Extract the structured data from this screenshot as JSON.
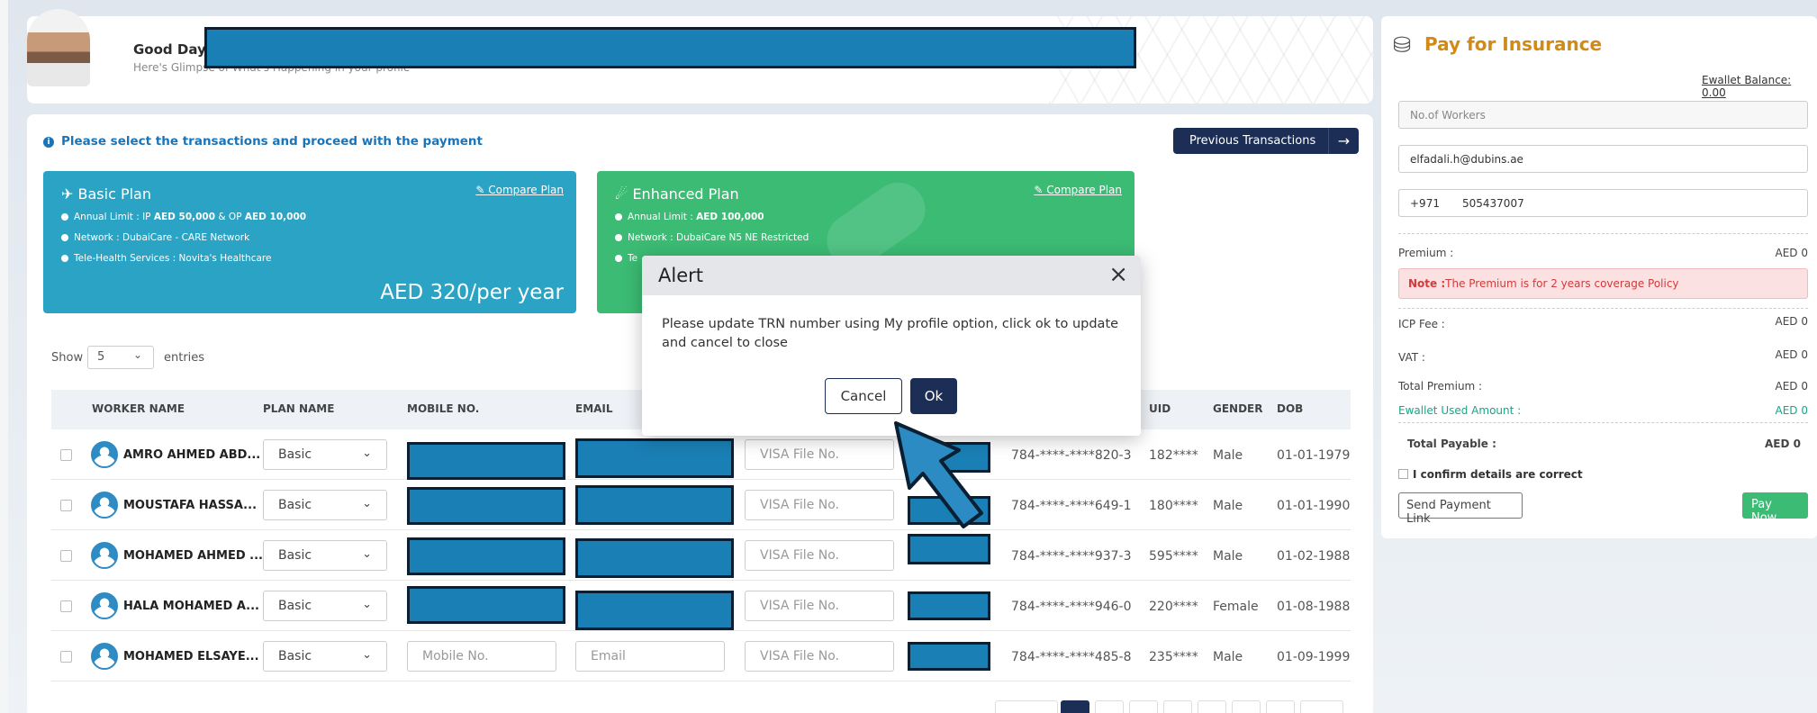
{
  "header": {
    "greeting": "Good Day",
    "subtitle": "Here's Glimpse of What's Happening in your profile"
  },
  "notice": "Please select the transactions and proceed with the payment",
  "previous_transactions_label": "Previous Transactions",
  "plans": [
    {
      "title": "Basic Plan",
      "compare": "Compare Plan",
      "features": [
        [
          "Annual Limit : IP ",
          "AED 50,000",
          " & OP ",
          "AED 10,000"
        ],
        [
          "Network : DubaiCare - CARE Network"
        ],
        [
          "Tele-Health Services : Novita's Healthcare"
        ]
      ],
      "price": "AED 320/per year"
    },
    {
      "title": "Enhanced Plan",
      "compare": "Compare Plan",
      "features": [
        [
          "Annual Limit : ",
          "AED 100,000"
        ],
        [
          "Network : DubaiCare N5 NE Restricted"
        ],
        [
          "Te"
        ]
      ],
      "price": ""
    }
  ],
  "table_controls": {
    "show": "Show",
    "page_size": "5",
    "entries": "entries"
  },
  "table": {
    "headers": [
      "WORKER NAME",
      "PLAN NAME",
      "MOBILE NO.",
      "EMAIL",
      "UID",
      "GENDER",
      "DOB"
    ],
    "rows": [
      {
        "name": "AMRO AHMED ABD...",
        "plan": "Basic",
        "visa_placeholder": "VISA File No.",
        "eid": "784-****-****820-3",
        "uid": "182****",
        "gender": "Male",
        "dob": "01-01-1979"
      },
      {
        "name": "MOUSTAFA HASSA...",
        "plan": "Basic",
        "visa_placeholder": "VISA File No.",
        "eid": "784-****-****649-1",
        "uid": "180****",
        "gender": "Male",
        "dob": "01-01-1990"
      },
      {
        "name": "MOHAMED AHMED ...",
        "plan": "Basic",
        "visa_placeholder": "VISA File No.",
        "eid": "784-****-****937-3",
        "uid": "595****",
        "gender": "Male",
        "dob": "01-02-1988"
      },
      {
        "name": "HALA MOHAMED A...",
        "plan": "Basic",
        "visa_placeholder": "VISA File No.",
        "eid": "784-****-****946-0",
        "uid": "220****",
        "gender": "Female",
        "dob": "01-08-1988"
      },
      {
        "name": "MOHAMED ELSAYE...",
        "plan": "Basic",
        "mobile_placeholder": "Mobile No.",
        "email_placeholder": "Email",
        "visa_placeholder": "VISA File No.",
        "eid": "784-****-****485-8",
        "uid": "235****",
        "gender": "Male",
        "dob": "01-09-1999"
      }
    ]
  },
  "side_panel": {
    "title": "Pay for Insurance",
    "ewallet_balance": "Ewallet Balance: 0.00",
    "workers_placeholder": "No.of Workers",
    "email": "elfadali.h@dubins.ae",
    "country_code": "+971",
    "phone": "505437007",
    "premium_label": "Premium :",
    "premium_value": "AED 0",
    "note_bold": "Note :",
    "note_text": "The Premium is for 2 years coverage Policy",
    "icp_label": "ICP Fee :",
    "icp_value": "AED 0",
    "vat_label": "VAT :",
    "vat_value": "AED 0",
    "total_premium_label": "Total Premium :",
    "total_premium_value": "AED 0",
    "ewallet_used_label": "Ewallet Used Amount :",
    "ewallet_used_value": "AED 0",
    "total_payable_label": "Total Payable :",
    "total_payable_value": "AED 0",
    "confirm_label": "I confirm details are correct",
    "send_link_label": "Send Payment Link",
    "pay_now_label": "Pay Now"
  },
  "modal": {
    "title": "Alert",
    "close_glyph": "×",
    "message": "Please update TRN number using My profile option, click ok to update and cancel to close",
    "cancel_label": "Cancel",
    "ok_label": "Ok"
  },
  "colors": {
    "navy": "#1c2e55",
    "basic_plan": "#2aa3c4",
    "enhanced_plan": "#3bbb73",
    "insurance_title": "#d18a17",
    "redaction": "#1a7fb5"
  }
}
